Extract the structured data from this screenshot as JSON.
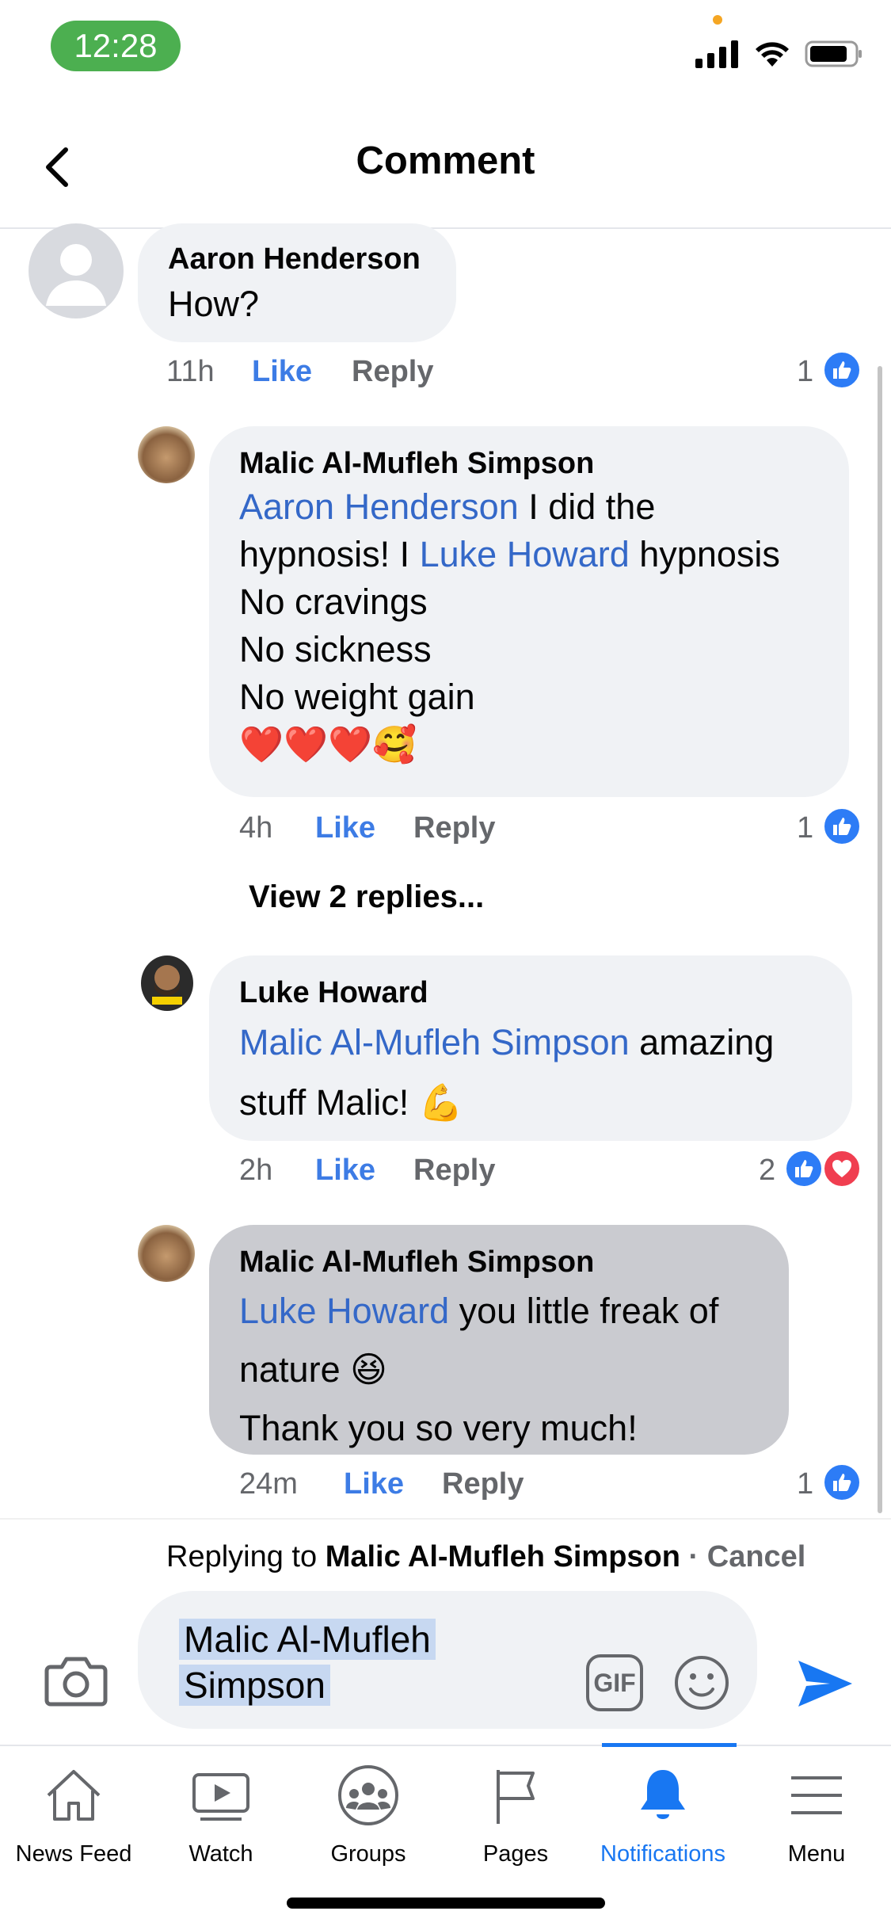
{
  "status": {
    "time": "12:28"
  },
  "header": {
    "title": "Comment"
  },
  "comments": [
    {
      "author": "Aaron Henderson",
      "lines": [
        [
          {
            "t": "How?"
          }
        ]
      ],
      "time": "11h",
      "like": "Like",
      "reply": "Reply",
      "reaction_count": "1",
      "reactions": [
        "like"
      ]
    },
    {
      "author": "Malic Al-Mufleh Simpson",
      "lines": [
        [
          {
            "t": "Aaron Henderson",
            "m": true
          },
          {
            "t": " I did the"
          }
        ],
        [
          {
            "t": "hypnosis! I "
          },
          {
            "t": "Luke Howard",
            "m": true
          },
          {
            "t": " hypnosis"
          }
        ],
        [
          {
            "t": "No cravings"
          }
        ],
        [
          {
            "t": "No sickness"
          }
        ],
        [
          {
            "t": "No weight gain"
          }
        ],
        [
          {
            "t": "❤️❤️❤️🥰"
          }
        ]
      ],
      "time": "4h",
      "like": "Like",
      "reply": "Reply",
      "reaction_count": "1",
      "reactions": [
        "like"
      ]
    },
    {
      "author": "Luke Howard",
      "lines": [
        [
          {
            "t": "Malic Al-Mufleh Simpson",
            "m": true
          },
          {
            "t": " amazing"
          }
        ],
        [
          {
            "t": "stuff Malic! 💪"
          }
        ]
      ],
      "time": "2h",
      "like": "Like",
      "reply": "Reply",
      "reaction_count": "2",
      "reactions": [
        "like",
        "love"
      ]
    },
    {
      "author": "Malic Al-Mufleh Simpson",
      "lines": [
        [
          {
            "t": "Luke Howard",
            "m": true
          },
          {
            "t": " you little freak of"
          }
        ],
        [
          {
            "t": "nature 😆"
          }
        ],
        [
          {
            "t": "Thank you so very much!"
          }
        ]
      ],
      "time": "24m",
      "like": "Like",
      "reply": "Reply",
      "reaction_count": "1",
      "reactions": [
        "like"
      ]
    }
  ],
  "view_replies": "View 2 replies...",
  "reply_bar": {
    "replying_prefix": "Replying to",
    "replying_to": "Malic Al-Mufleh Simpson",
    "separator": "·",
    "cancel": "Cancel",
    "input_value_line1": "Malic Al-Mufleh",
    "input_value_line2": "Simpson",
    "gif_label": "GIF"
  },
  "tabs": [
    {
      "label": "News Feed",
      "icon": "home-icon"
    },
    {
      "label": "Watch",
      "icon": "watch-icon"
    },
    {
      "label": "Groups",
      "icon": "groups-icon"
    },
    {
      "label": "Pages",
      "icon": "flag-icon"
    },
    {
      "label": "Notifications",
      "icon": "bell-icon",
      "active": true
    },
    {
      "label": "Menu",
      "icon": "menu-icon"
    }
  ],
  "colors": {
    "mention": "#3468c8",
    "like_blue": "#3d7ce5",
    "active_tab": "#1877f2",
    "love_red": "#f03e50",
    "status_pill": "#4caf50"
  }
}
